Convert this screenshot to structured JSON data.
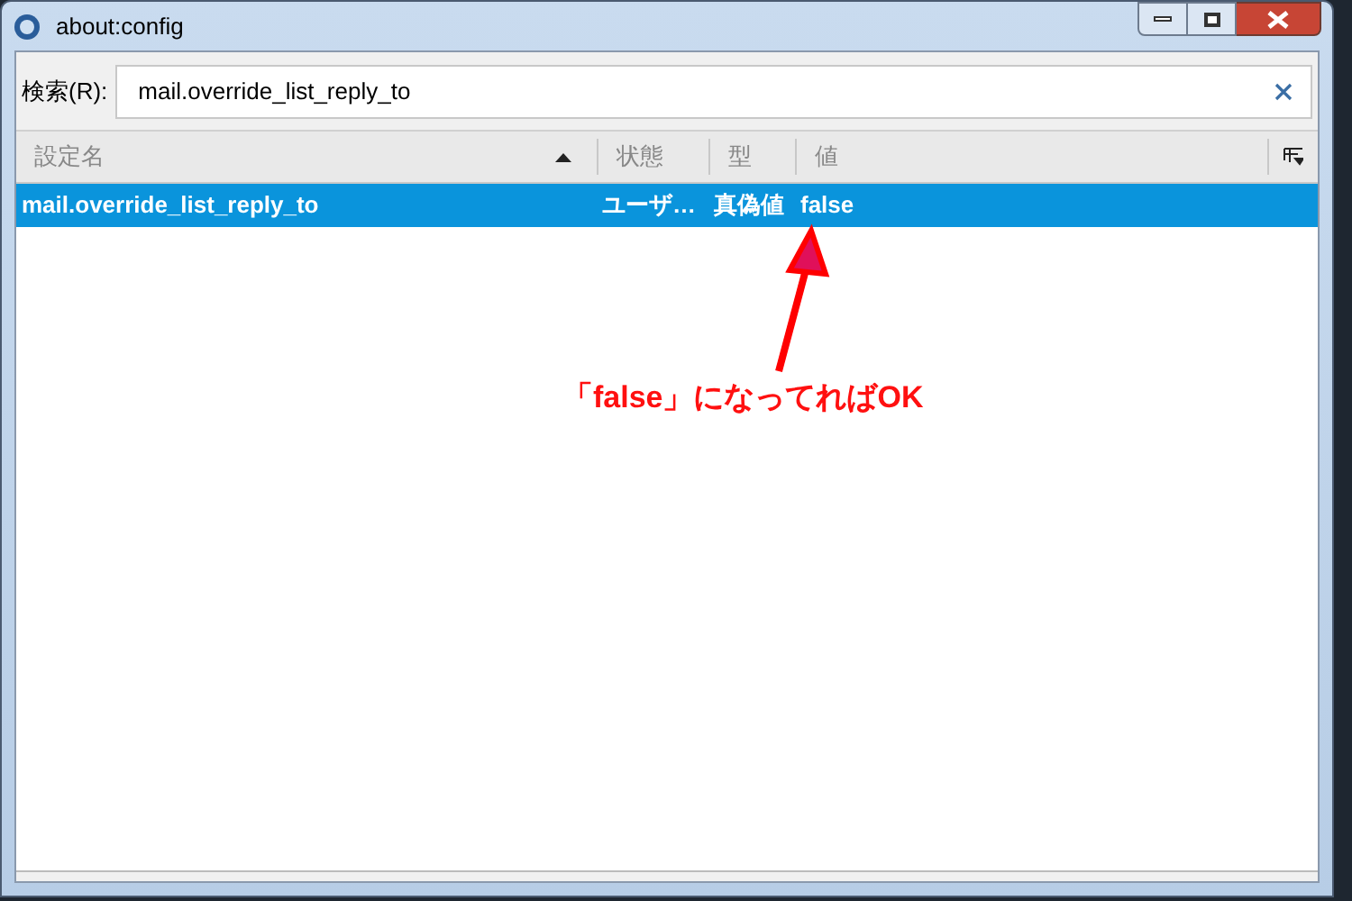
{
  "window": {
    "title": "about:config"
  },
  "search": {
    "label": "検索(R):",
    "value": "mail.override_list_reply_to"
  },
  "table": {
    "columns": [
      {
        "label": "設定名",
        "sorted": true
      },
      {
        "label": "状態",
        "sorted": false
      },
      {
        "label": "型",
        "sorted": false
      },
      {
        "label": "値",
        "sorted": false
      }
    ],
    "rows": [
      {
        "cells": [
          "mail.override_list_reply_to",
          "ユーザ…",
          "真偽値",
          "false"
        ],
        "selected": true
      }
    ]
  },
  "annotation": {
    "text": "「false」になってればOK"
  }
}
